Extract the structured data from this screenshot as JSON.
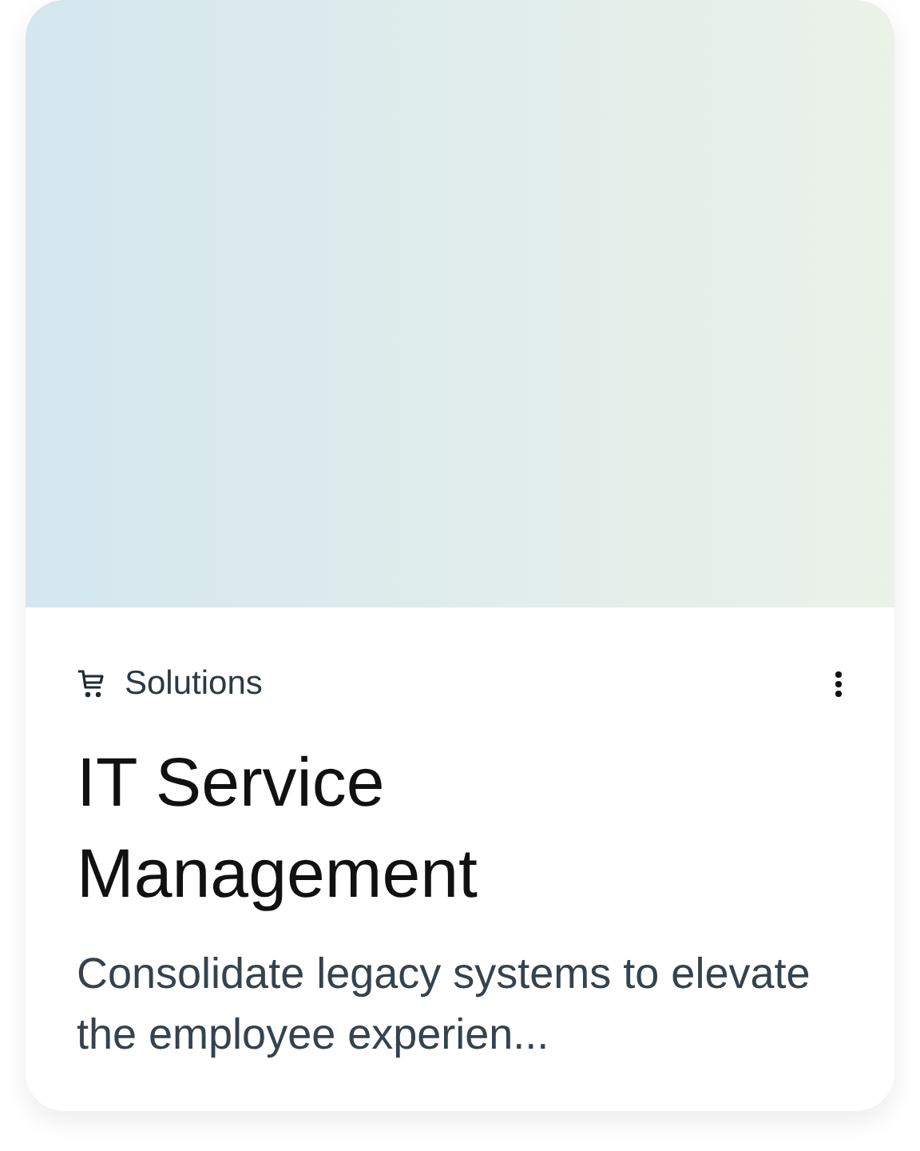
{
  "card": {
    "category": "Solutions",
    "title": "IT Service Management",
    "description": "Consolidate legacy systems to elevate the employee experien..."
  }
}
